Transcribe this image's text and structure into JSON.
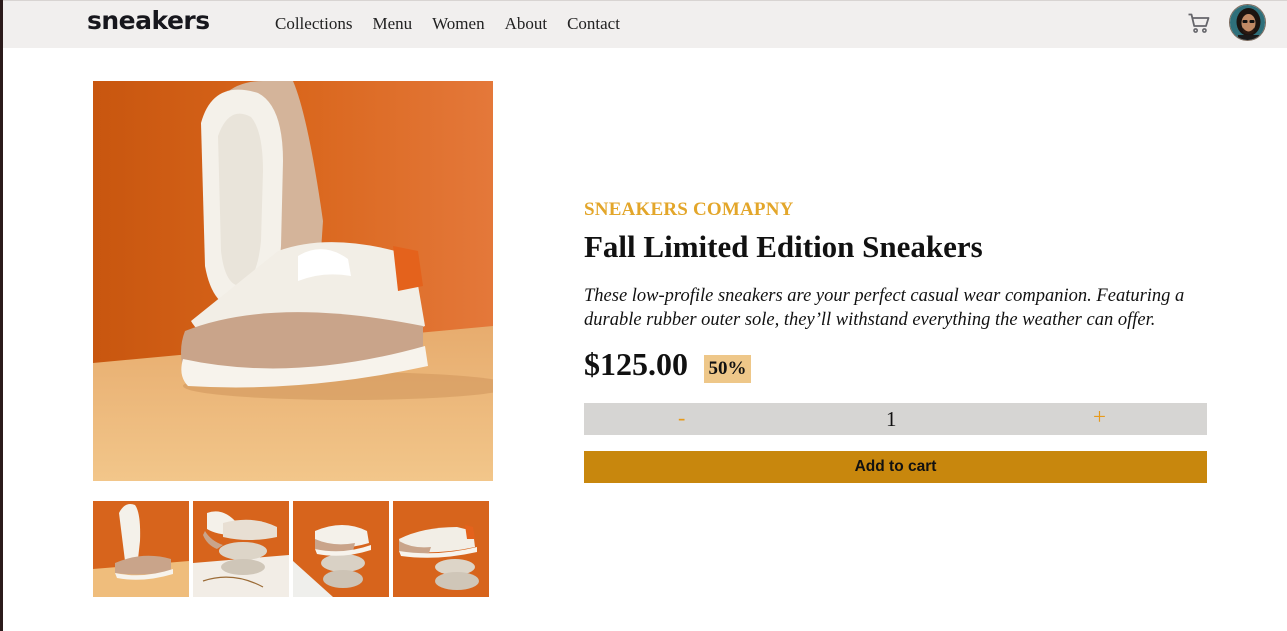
{
  "header": {
    "logo": "sneakers",
    "nav": [
      "Collections",
      "Menu",
      "Women",
      "About",
      "Contact"
    ],
    "cart_icon": "cart-icon",
    "avatar_icon": "user-avatar"
  },
  "product": {
    "company": "SNEAKERS COMAPNY",
    "title": "Fall Limited Edition Sneakers",
    "description": "These low-profile sneakers are your perfect casual wear companion. Featuring a durable rubber outer sole, they’ll withstand everything the weather can offer.",
    "price": "$125.00",
    "discount": "50%",
    "quantity": {
      "minus": "-",
      "value": "1",
      "plus": "+"
    },
    "add_to_cart": "Add to cart"
  },
  "colors": {
    "accent": "#e3a62a",
    "button": "#c8870d",
    "discount_bg": "#eec789",
    "photo_orange": "#d4631a",
    "photo_sand": "#efbd7c"
  }
}
